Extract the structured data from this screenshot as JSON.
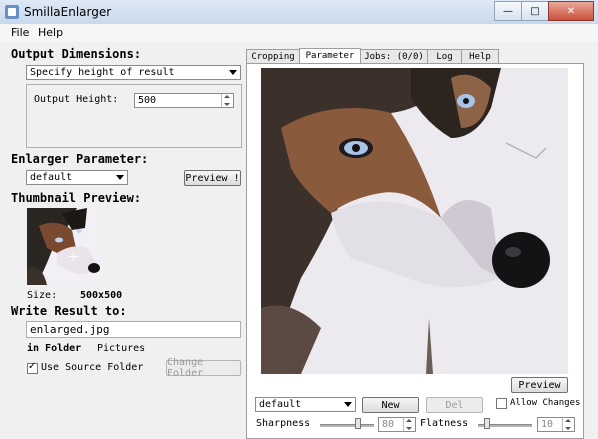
{
  "window": {
    "title": "SmillaEnlarger",
    "minimize": "—",
    "maximize": "□",
    "close": "✕"
  },
  "menu": {
    "file": "File",
    "help": "Help"
  },
  "output_dimensions": {
    "label": "Output Dimensions:",
    "mode": "Specify height of result",
    "height_label": "Output Height:",
    "height_value": "500"
  },
  "enlarger": {
    "label": "Enlarger Parameter:",
    "preset": "default",
    "preview_button": "Preview !"
  },
  "thumbnail": {
    "label": "Thumbnail Preview:",
    "size_label": "Size:",
    "size_value": "500x500"
  },
  "write_result": {
    "label": "Write Result to:",
    "filename": "enlarged.jpg",
    "folder_label": "in Folder",
    "folder_value": "Pictures",
    "use_source_label": "Use Source Folder",
    "use_source_checked": true,
    "change_folder_button": "Change Folder"
  },
  "tabs": [
    {
      "label": "Cropping",
      "active": false
    },
    {
      "label": "Parameter",
      "active": true
    },
    {
      "label": "Jobs: (0/0)",
      "active": false
    },
    {
      "label": "Log",
      "active": false
    },
    {
      "label": "Help",
      "active": false
    }
  ],
  "parameter_panel": {
    "preview_button": "Preview",
    "preset": "default",
    "new_button": "New",
    "del_button": "Del",
    "allow_changes_label": "Allow Changes",
    "allow_changes_checked": false,
    "sharpness_label": "Sharpness",
    "sharpness_value": "80",
    "flatness_label": "Flatness",
    "flatness_value": "10"
  }
}
